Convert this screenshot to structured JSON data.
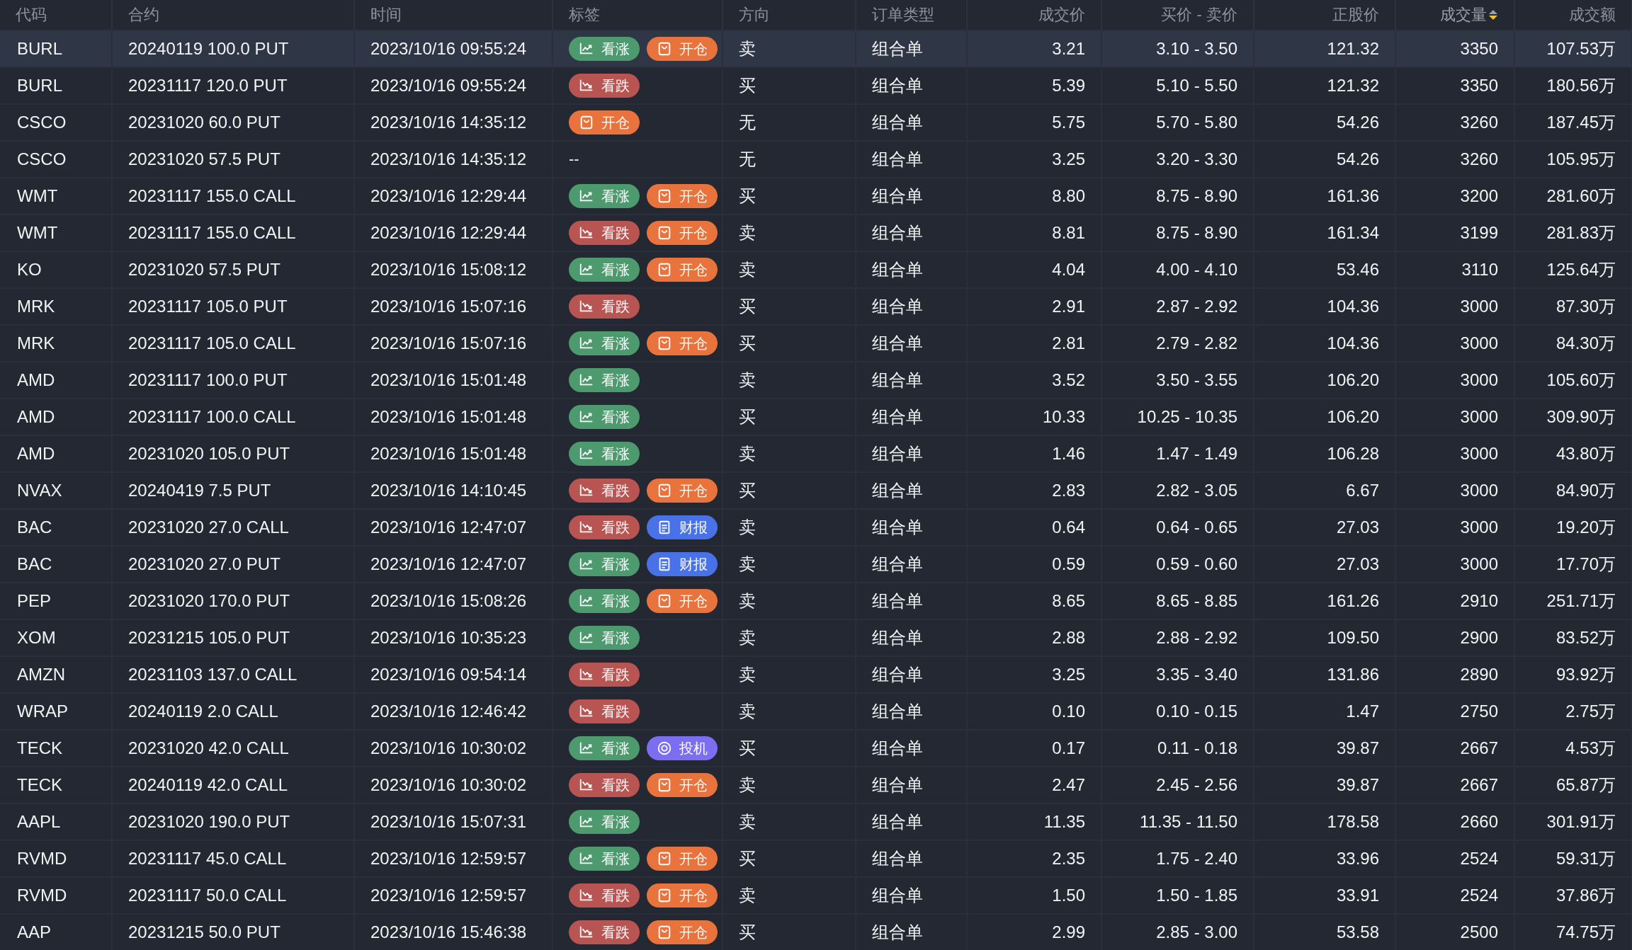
{
  "table": {
    "columns": [
      {
        "label": "代码",
        "sorted": false
      },
      {
        "label": "合约",
        "sorted": false
      },
      {
        "label": "时间",
        "sorted": false
      },
      {
        "label": "标签",
        "sorted": false
      },
      {
        "label": "方向",
        "sorted": false
      },
      {
        "label": "订单类型",
        "sorted": false
      },
      {
        "label": "成交价",
        "sorted": false
      },
      {
        "label": "买价 - 卖价",
        "sorted": false
      },
      {
        "label": "正股价",
        "sorted": false
      },
      {
        "label": "成交量",
        "sorted": true
      },
      {
        "label": "成交额",
        "sorted": false
      }
    ],
    "rows": [
      {
        "selected": true,
        "code": "BURL",
        "contract": "20240119 100.0 PUT",
        "time": "2023/10/16 09:55:24",
        "tags": [
          {
            "kind": "bull",
            "label": "看涨",
            "color": "#4e9a6f"
          },
          {
            "kind": "open",
            "label": "开仓",
            "color": "#e8733c"
          }
        ],
        "direction": "卖",
        "order_type": "组合单",
        "price": "3.21",
        "bid_ask": "3.10 - 3.50",
        "stock_price": "121.32",
        "volume": "3350",
        "amount": "107.53万"
      },
      {
        "selected": false,
        "code": "BURL",
        "contract": "20231117 120.0 PUT",
        "time": "2023/10/16 09:55:24",
        "tags": [
          {
            "kind": "bear",
            "label": "看跌",
            "color": "#b85552"
          }
        ],
        "direction": "买",
        "order_type": "组合单",
        "price": "5.39",
        "bid_ask": "5.10 - 5.50",
        "stock_price": "121.32",
        "volume": "3350",
        "amount": "180.56万"
      },
      {
        "selected": false,
        "code": "CSCO",
        "contract": "20231020 60.0 PUT",
        "time": "2023/10/16 14:35:12",
        "tags": [
          {
            "kind": "open",
            "label": "开仓",
            "color": "#e8733c"
          }
        ],
        "direction": "无",
        "order_type": "组合单",
        "price": "5.75",
        "bid_ask": "5.70 - 5.80",
        "stock_price": "54.26",
        "volume": "3260",
        "amount": "187.45万"
      },
      {
        "selected": false,
        "code": "CSCO",
        "contract": "20231020 57.5 PUT",
        "time": "2023/10/16 14:35:12",
        "tags": [],
        "tags_text": "--",
        "direction": "无",
        "order_type": "组合单",
        "price": "3.25",
        "bid_ask": "3.20 - 3.30",
        "stock_price": "54.26",
        "volume": "3260",
        "amount": "105.95万"
      },
      {
        "selected": false,
        "code": "WMT",
        "contract": "20231117 155.0 CALL",
        "time": "2023/10/16 12:29:44",
        "tags": [
          {
            "kind": "bull",
            "label": "看涨",
            "color": "#4e9a6f"
          },
          {
            "kind": "open",
            "label": "开仓",
            "color": "#e8733c"
          }
        ],
        "direction": "买",
        "order_type": "组合单",
        "price": "8.80",
        "bid_ask": "8.75 - 8.90",
        "stock_price": "161.36",
        "volume": "3200",
        "amount": "281.60万"
      },
      {
        "selected": false,
        "code": "WMT",
        "contract": "20231117 155.0 CALL",
        "time": "2023/10/16 12:29:44",
        "tags": [
          {
            "kind": "bear",
            "label": "看跌",
            "color": "#b85552"
          },
          {
            "kind": "open",
            "label": "开仓",
            "color": "#e8733c"
          }
        ],
        "direction": "卖",
        "order_type": "组合单",
        "price": "8.81",
        "bid_ask": "8.75 - 8.90",
        "stock_price": "161.34",
        "volume": "3199",
        "amount": "281.83万"
      },
      {
        "selected": false,
        "code": "KO",
        "contract": "20231020 57.5 PUT",
        "time": "2023/10/16 15:08:12",
        "tags": [
          {
            "kind": "bull",
            "label": "看涨",
            "color": "#4e9a6f"
          },
          {
            "kind": "open",
            "label": "开仓",
            "color": "#e8733c"
          }
        ],
        "direction": "卖",
        "order_type": "组合单",
        "price": "4.04",
        "bid_ask": "4.00 - 4.10",
        "stock_price": "53.46",
        "volume": "3110",
        "amount": "125.64万"
      },
      {
        "selected": false,
        "code": "MRK",
        "contract": "20231117 105.0 PUT",
        "time": "2023/10/16 15:07:16",
        "tags": [
          {
            "kind": "bear",
            "label": "看跌",
            "color": "#b85552"
          }
        ],
        "direction": "买",
        "order_type": "组合单",
        "price": "2.91",
        "bid_ask": "2.87 - 2.92",
        "stock_price": "104.36",
        "volume": "3000",
        "amount": "87.30万"
      },
      {
        "selected": false,
        "code": "MRK",
        "contract": "20231117 105.0 CALL",
        "time": "2023/10/16 15:07:16",
        "tags": [
          {
            "kind": "bull",
            "label": "看涨",
            "color": "#4e9a6f"
          },
          {
            "kind": "open",
            "label": "开仓",
            "color": "#e8733c"
          }
        ],
        "direction": "买",
        "order_type": "组合单",
        "price": "2.81",
        "bid_ask": "2.79 - 2.82",
        "stock_price": "104.36",
        "volume": "3000",
        "amount": "84.30万"
      },
      {
        "selected": false,
        "code": "AMD",
        "contract": "20231117 100.0 PUT",
        "time": "2023/10/16 15:01:48",
        "tags": [
          {
            "kind": "bull",
            "label": "看涨",
            "color": "#4e9a6f"
          }
        ],
        "direction": "卖",
        "order_type": "组合单",
        "price": "3.52",
        "bid_ask": "3.50 - 3.55",
        "stock_price": "106.20",
        "volume": "3000",
        "amount": "105.60万"
      },
      {
        "selected": false,
        "code": "AMD",
        "contract": "20231117 100.0 CALL",
        "time": "2023/10/16 15:01:48",
        "tags": [
          {
            "kind": "bull",
            "label": "看涨",
            "color": "#4e9a6f"
          }
        ],
        "direction": "买",
        "order_type": "组合单",
        "price": "10.33",
        "bid_ask": "10.25 - 10.35",
        "stock_price": "106.20",
        "volume": "3000",
        "amount": "309.90万"
      },
      {
        "selected": false,
        "code": "AMD",
        "contract": "20231020 105.0 PUT",
        "time": "2023/10/16 15:01:48",
        "tags": [
          {
            "kind": "bull",
            "label": "看涨",
            "color": "#4e9a6f"
          }
        ],
        "direction": "卖",
        "order_type": "组合单",
        "price": "1.46",
        "bid_ask": "1.47 - 1.49",
        "stock_price": "106.28",
        "volume": "3000",
        "amount": "43.80万"
      },
      {
        "selected": false,
        "code": "NVAX",
        "contract": "20240419 7.5 PUT",
        "time": "2023/10/16 14:10:45",
        "tags": [
          {
            "kind": "bear",
            "label": "看跌",
            "color": "#b85552"
          },
          {
            "kind": "open",
            "label": "开仓",
            "color": "#e8733c"
          }
        ],
        "direction": "买",
        "order_type": "组合单",
        "price": "2.83",
        "bid_ask": "2.82 - 3.05",
        "stock_price": "6.67",
        "volume": "3000",
        "amount": "84.90万"
      },
      {
        "selected": false,
        "code": "BAC",
        "contract": "20231020 27.0 CALL",
        "time": "2023/10/16 12:47:07",
        "tags": [
          {
            "kind": "bear",
            "label": "看跌",
            "color": "#b85552"
          },
          {
            "kind": "earnings",
            "label": "财报",
            "color": "#4a72e8"
          }
        ],
        "direction": "卖",
        "order_type": "组合单",
        "price": "0.64",
        "bid_ask": "0.64 - 0.65",
        "stock_price": "27.03",
        "volume": "3000",
        "amount": "19.20万"
      },
      {
        "selected": false,
        "code": "BAC",
        "contract": "20231020 27.0 PUT",
        "time": "2023/10/16 12:47:07",
        "tags": [
          {
            "kind": "bull",
            "label": "看涨",
            "color": "#4e9a6f"
          },
          {
            "kind": "earnings",
            "label": "财报",
            "color": "#4a72e8"
          }
        ],
        "direction": "卖",
        "order_type": "组合单",
        "price": "0.59",
        "bid_ask": "0.59 - 0.60",
        "stock_price": "27.03",
        "volume": "3000",
        "amount": "17.70万"
      },
      {
        "selected": false,
        "code": "PEP",
        "contract": "20231020 170.0 PUT",
        "time": "2023/10/16 15:08:26",
        "tags": [
          {
            "kind": "bull",
            "label": "看涨",
            "color": "#4e9a6f"
          },
          {
            "kind": "open",
            "label": "开仓",
            "color": "#e8733c"
          }
        ],
        "direction": "卖",
        "order_type": "组合单",
        "price": "8.65",
        "bid_ask": "8.65 - 8.85",
        "stock_price": "161.26",
        "volume": "2910",
        "amount": "251.71万"
      },
      {
        "selected": false,
        "code": "XOM",
        "contract": "20231215 105.0 PUT",
        "time": "2023/10/16 10:35:23",
        "tags": [
          {
            "kind": "bull",
            "label": "看涨",
            "color": "#4e9a6f"
          }
        ],
        "direction": "卖",
        "order_type": "组合单",
        "price": "2.88",
        "bid_ask": "2.88 - 2.92",
        "stock_price": "109.50",
        "volume": "2900",
        "amount": "83.52万"
      },
      {
        "selected": false,
        "code": "AMZN",
        "contract": "20231103 137.0 CALL",
        "time": "2023/10/16 09:54:14",
        "tags": [
          {
            "kind": "bear",
            "label": "看跌",
            "color": "#b85552"
          }
        ],
        "direction": "卖",
        "order_type": "组合单",
        "price": "3.25",
        "bid_ask": "3.35 - 3.40",
        "stock_price": "131.86",
        "volume": "2890",
        "amount": "93.92万"
      },
      {
        "selected": false,
        "code": "WRAP",
        "contract": "20240119 2.0 CALL",
        "time": "2023/10/16 12:46:42",
        "tags": [
          {
            "kind": "bear",
            "label": "看跌",
            "color": "#b85552"
          }
        ],
        "direction": "卖",
        "order_type": "组合单",
        "price": "0.10",
        "bid_ask": "0.10 - 0.15",
        "stock_price": "1.47",
        "volume": "2750",
        "amount": "2.75万"
      },
      {
        "selected": false,
        "code": "TECK",
        "contract": "20231020 42.0 CALL",
        "time": "2023/10/16 10:30:02",
        "tags": [
          {
            "kind": "bull",
            "label": "看涨",
            "color": "#4e9a6f"
          },
          {
            "kind": "spec",
            "label": "投机",
            "color": "#7b6ef0"
          }
        ],
        "direction": "买",
        "order_type": "组合单",
        "price": "0.17",
        "bid_ask": "0.11 - 0.18",
        "stock_price": "39.87",
        "volume": "2667",
        "amount": "4.53万"
      },
      {
        "selected": false,
        "code": "TECK",
        "contract": "20240119 42.0 CALL",
        "time": "2023/10/16 10:30:02",
        "tags": [
          {
            "kind": "bear",
            "label": "看跌",
            "color": "#b85552"
          },
          {
            "kind": "open",
            "label": "开仓",
            "color": "#e8733c"
          }
        ],
        "direction": "卖",
        "order_type": "组合单",
        "price": "2.47",
        "bid_ask": "2.45 - 2.56",
        "stock_price": "39.87",
        "volume": "2667",
        "amount": "65.87万"
      },
      {
        "selected": false,
        "code": "AAPL",
        "contract": "20231020 190.0 PUT",
        "time": "2023/10/16 15:07:31",
        "tags": [
          {
            "kind": "bull",
            "label": "看涨",
            "color": "#4e9a6f"
          }
        ],
        "direction": "卖",
        "order_type": "组合单",
        "price": "11.35",
        "bid_ask": "11.35 - 11.50",
        "stock_price": "178.58",
        "volume": "2660",
        "amount": "301.91万"
      },
      {
        "selected": false,
        "code": "RVMD",
        "contract": "20231117 45.0 CALL",
        "time": "2023/10/16 12:59:57",
        "tags": [
          {
            "kind": "bull",
            "label": "看涨",
            "color": "#4e9a6f"
          },
          {
            "kind": "open",
            "label": "开仓",
            "color": "#e8733c"
          }
        ],
        "direction": "买",
        "order_type": "组合单",
        "price": "2.35",
        "bid_ask": "1.75 - 2.40",
        "stock_price": "33.96",
        "volume": "2524",
        "amount": "59.31万"
      },
      {
        "selected": false,
        "code": "RVMD",
        "contract": "20231117 50.0 CALL",
        "time": "2023/10/16 12:59:57",
        "tags": [
          {
            "kind": "bear",
            "label": "看跌",
            "color": "#b85552"
          },
          {
            "kind": "open",
            "label": "开仓",
            "color": "#e8733c"
          }
        ],
        "direction": "卖",
        "order_type": "组合单",
        "price": "1.50",
        "bid_ask": "1.50 - 1.85",
        "stock_price": "33.91",
        "volume": "2524",
        "amount": "37.86万"
      },
      {
        "selected": false,
        "code": "AAP",
        "contract": "20231215 50.0 PUT",
        "time": "2023/10/16 15:46:38",
        "tags": [
          {
            "kind": "bear",
            "label": "看跌",
            "color": "#b85552"
          },
          {
            "kind": "open",
            "label": "开仓",
            "color": "#e8733c"
          }
        ],
        "direction": "买",
        "order_type": "组合单",
        "price": "2.99",
        "bid_ask": "2.85 - 3.00",
        "stock_price": "53.58",
        "volume": "2500",
        "amount": "74.75万"
      }
    ]
  }
}
